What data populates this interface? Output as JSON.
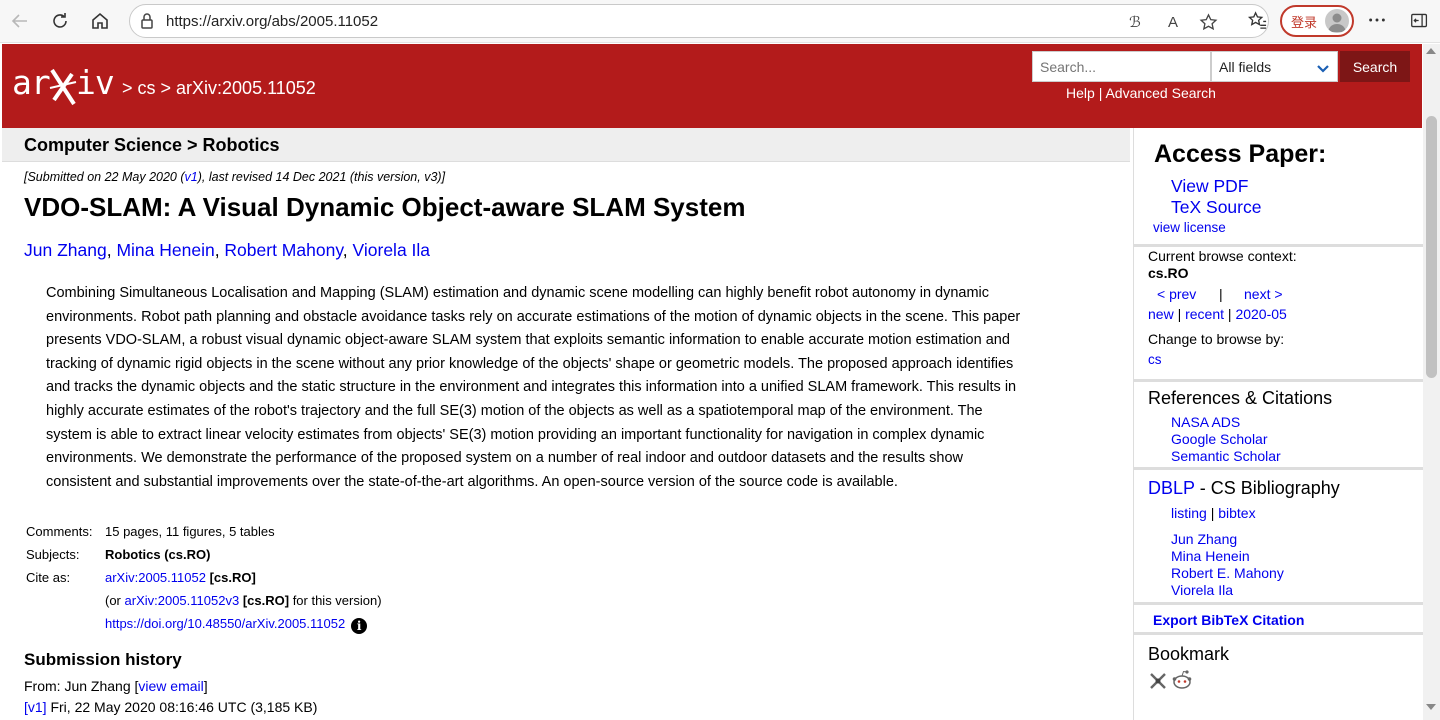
{
  "browser": {
    "url": "https://arxiv.org/abs/2005.11052",
    "login_label": "登录"
  },
  "header": {
    "logo_text": "arXiv",
    "breadcrumb": "> cs > arXiv:2005.11052",
    "search_placeholder": "Search...",
    "search_field": "All fields",
    "search_button": "Search",
    "help_label": "Help",
    "separator": "|",
    "advanced_label": "Advanced Search",
    "brand_color": "#b31b1b"
  },
  "main": {
    "subject_header": "Computer Science > Robotics",
    "dateline_prefix": "[Submitted on 22 May 2020 (",
    "dateline_v1": "v1",
    "dateline_suffix": "), last revised 14 Dec 2021 (this version, v3)]",
    "title": "VDO-SLAM: A Visual Dynamic Object-aware SLAM System",
    "authors": [
      "Jun Zhang",
      "Mina Henein",
      "Robert Mahony",
      "Viorela Ila"
    ],
    "abstract_lines": [
      "Combining Simultaneous Localisation and Mapping (SLAM) estimation and dynamic scene modelling can highly benefit robot autonomy in dynamic",
      "environments. Robot path planning and obstacle avoidance tasks rely on accurate estimations of the motion of dynamic objects in the scene. This paper",
      "presents VDO-SLAM, a robust visual dynamic object-aware SLAM system that exploits semantic information to enable accurate motion estimation and",
      "tracking of dynamic rigid objects in the scene without any prior knowledge of the objects' shape or geometric models. The proposed approach identifies",
      "and tracks the dynamic objects and the static structure in the environment and integrates this information into a unified SLAM framework. This results in",
      "highly accurate estimates of the robot's trajectory and the full SE(3) motion of the objects as well as a spatiotemporal map of the environment. The",
      "system is able to extract linear velocity estimates from objects' SE(3) motion providing an important functionality for navigation in complex dynamic",
      "environments. We demonstrate the performance of the proposed system on a number of real indoor and outdoor datasets and the results show",
      "consistent and substantial improvements over the state-of-the-art algorithms. An open-source version of the source code is available."
    ],
    "comments_label": "Comments:",
    "comments": "15 pages, 11 figures, 5 tables",
    "subjects_label": "Subjects:",
    "subjects": "Robotics (cs.RO)",
    "cite_label": "Cite as:",
    "cite_id": "arXiv:2005.11052",
    "cite_tag": "[cs.RO]",
    "cite_alt_prefix": "(or",
    "cite_alt_id": "arXiv:2005.11052v3",
    "cite_alt_tag": "[cs.RO]",
    "cite_alt_suffix": "for this version)",
    "doi": "https://doi.org/10.48550/arXiv.2005.11052",
    "history_title": "Submission history",
    "from_prefix": "From: Jun Zhang [",
    "view_email": "view email",
    "from_suffix": "]",
    "v1_label": "[v1]",
    "v1_text": "Fri, 22 May 2020 08:16:46 UTC (3,185 KB)"
  },
  "sidebar": {
    "access_title": "Access Paper:",
    "view_pdf": "View PDF",
    "tex_source": "TeX Source",
    "view_license": "view license",
    "browse_context_label": "Current browse context:",
    "browse_context": "cs.RO",
    "prev": "< prev",
    "pipe": "|",
    "next": "next >",
    "new": "new",
    "recent": "recent",
    "month": "2020-05",
    "change_browse": "Change to browse by:",
    "cs": "cs",
    "refs_title": "References & Citations",
    "nasa": "NASA ADS",
    "google": "Google Scholar",
    "semantic": "Semantic Scholar",
    "dblp": "DBLP",
    "dblp_suffix": " - CS Bibliography",
    "listing": "listing",
    "bibtex": "bibtex",
    "dblp_authors": [
      "Jun Zhang",
      "Mina Henein",
      "Robert E. Mahony",
      "Viorela Ila"
    ],
    "export_bibtex": "Export BibTeX Citation",
    "bookmark_title": "Bookmark"
  }
}
